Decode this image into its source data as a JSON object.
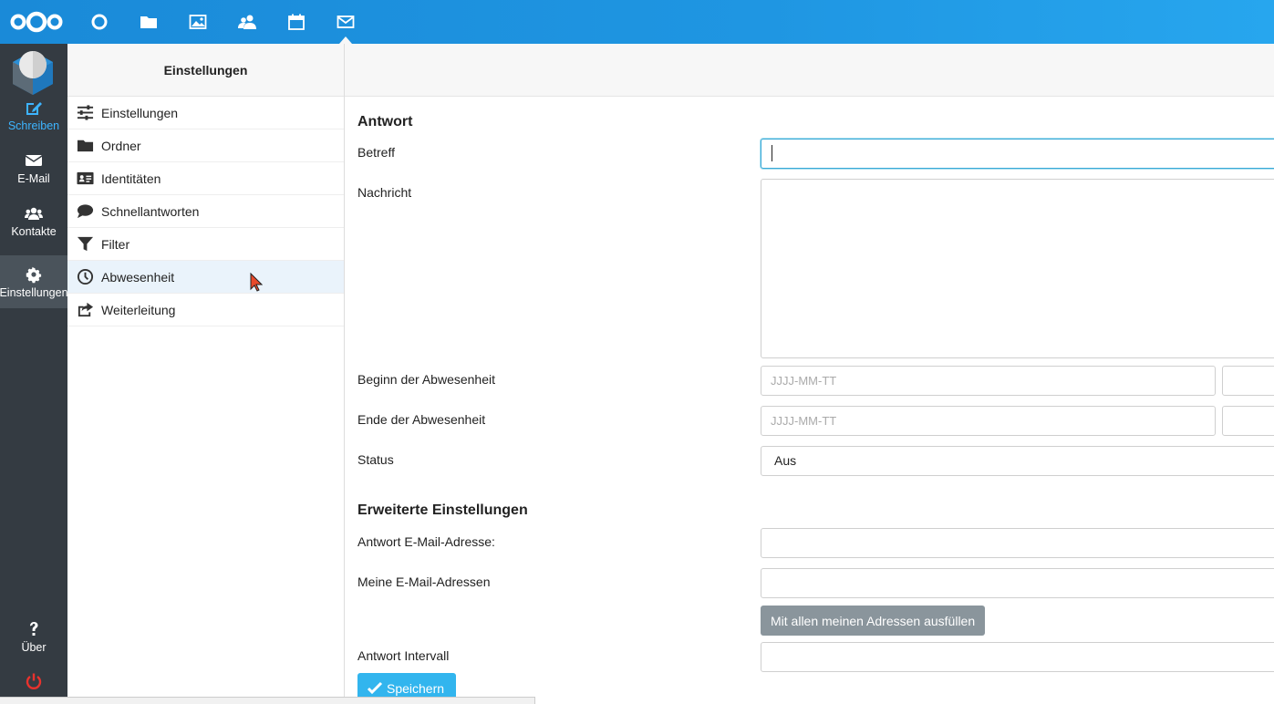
{
  "colors": {
    "topbar": "#1f96e2",
    "rail": "#343b42",
    "accent": "#32b5ee",
    "active_rail": "#4a535b"
  },
  "topnav": {
    "icons": [
      "nextcloud-logo",
      "dashboard-icon",
      "files-icon",
      "photos-icon",
      "contacts-icon",
      "calendar-icon",
      "mail-icon"
    ]
  },
  "rail": {
    "items": [
      {
        "label": "Schreiben",
        "icon": "compose-icon"
      },
      {
        "label": "E-Mail",
        "icon": "envelope-icon"
      },
      {
        "label": "Kontakte",
        "icon": "users-icon"
      },
      {
        "label": "Einstellungen",
        "icon": "gear-icon"
      },
      {
        "label": "Über",
        "icon": "question-icon"
      },
      {
        "label": "",
        "icon": "power-icon"
      }
    ]
  },
  "sidebar": {
    "title": "Einstellungen",
    "items": [
      {
        "label": "Einstellungen",
        "icon": "sliders-icon"
      },
      {
        "label": "Ordner",
        "icon": "folder-icon"
      },
      {
        "label": "Identitäten",
        "icon": "id-card-icon"
      },
      {
        "label": "Schnellantworten",
        "icon": "comment-icon"
      },
      {
        "label": "Filter",
        "icon": "filter-icon"
      },
      {
        "label": "Abwesenheit",
        "icon": "clock-icon"
      },
      {
        "label": "Weiterleitung",
        "icon": "share-icon"
      }
    ],
    "active": "Abwesenheit"
  },
  "form": {
    "section_reply": "Antwort",
    "subject_label": "Betreff",
    "subject_value": "",
    "message_label": "Nachricht",
    "message_value": "",
    "start_label": "Beginn der Abwesenheit",
    "start_placeholder": "JJJJ-MM-TT",
    "end_label": "Ende der Abwesenheit",
    "end_placeholder": "JJJJ-MM-TT",
    "status_label": "Status",
    "status_value": "Aus",
    "section_advanced": "Erweiterte Einstellungen",
    "reply_address_label": "Antwort E-Mail-Adresse:",
    "reply_address_value": "",
    "my_addresses_label": "Meine E-Mail-Adressen",
    "my_addresses_value": "",
    "fill_button": "Mit allen meinen Adressen ausfüllen",
    "interval_label": "Antwort Intervall",
    "interval_value": "",
    "save_button": "Speichern"
  }
}
